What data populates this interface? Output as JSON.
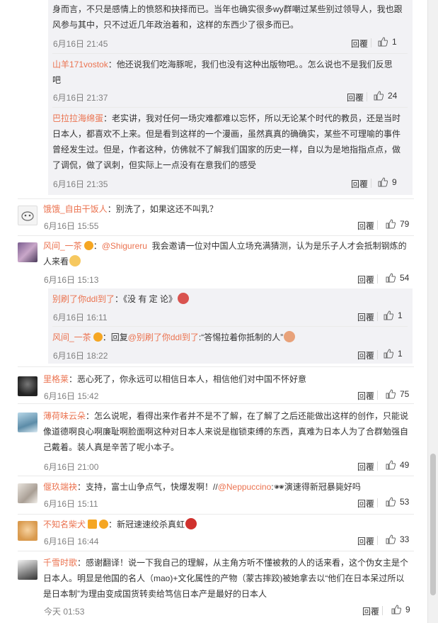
{
  "actions": {
    "reply": "回覆"
  },
  "thread_replies": [
    {
      "text_lines": [
        "身而言，不只是感情上的愤怒和抉择而已。当年也确实很多wy群嘲过某些别过领导人，我也跟",
        "风参与其中，只不过近几年政治着和，这样的东西少了很多而已。"
      ],
      "time": "6月16日 21:45",
      "likes": "1"
    },
    {
      "user": "山羊171vostok",
      "text_lines": [
        "：他还说我们吃海豚呢，我们也没有这种出版物吧。。怎么说也不是我们反思",
        "吧"
      ],
      "time": "6月16日 21:37",
      "likes": "24"
    },
    {
      "user": "巴拉拉海绵蛋",
      "text_lines": [
        "：老实讲，我对任何一场灾难都难以忘怀，所以无论某个时代的教员，还是当时",
        "日本人，都喜欢不上来。但是看到这样的一个漫画，虽然真真的确确实，某些不可理喻的事件",
        "曾经发生过。但是，作者这种，仿佛就不了解我们国家的历史一样，自以为是地指指点点，做",
        "了调侃，做了讽刺，但实际上一点没有在意我们的感受"
      ],
      "time": "6月16日 21:35",
      "likes": "9"
    }
  ],
  "comments": [
    {
      "user": "饿饿_自由干饭人",
      "text": "：别洗了，如果这还不叫乳？",
      "time": "6月16日 15:55",
      "likes": "79"
    },
    {
      "user": "风间_一茶",
      "mention": "@Shigureru",
      "text_lines": [
        "我会邀请一位对中国人立场充满猜测，认为是乐子人才会抵制钢炼的",
        "人来看"
      ],
      "time": "6月16日 15:13",
      "likes": "54",
      "replies": [
        {
          "user": "别刷了你ddl到了",
          "text": "：《没 有 定 论》",
          "time": "6月16日 16:11",
          "likes": "1"
        },
        {
          "user": "风间_一茶",
          "prefix": "：回复",
          "mention": "@别刷了你ddl到了",
          "text": ":“答惕拉着你抵制的人”",
          "time": "6月16日 18:22",
          "likes": "1"
        }
      ]
    },
    {
      "user": "里格莱",
      "text": "：恶心死了，你永远可以相信日本人，相信他们对中国不怀好意",
      "time": "6月16日 15:42",
      "likes": "75"
    },
    {
      "user": "薄荷味云朵",
      "text_lines": [
        "：怎么说呢，看得出来作者并不是不了解，在了解了之后还能做出这样的创作，只能说",
        "像道德啊良心啊廉耻啊脸面啊这种对日本人来说是枷锁束缚的东西，真难为日本人为了合群勉强自",
        "己戴着。装人真是辛苦了呢小本子。"
      ],
      "time": "6月16日 21:00",
      "likes": "49"
    },
    {
      "user": "偃玖端袂",
      "text": "：支持，富士山争点气，快爆发啊！//",
      "mention": "@Neppuccino",
      "text2": ":🕶演速得新冠暴毙好吗",
      "time": "6月16日 15:11",
      "likes": "53"
    },
    {
      "user": "不知名柴犬",
      "text": "：新冠速速绞杀真虹",
      "time": "6月16日 16:44",
      "likes": "33"
    },
    {
      "user": "千雪时歌",
      "text_lines": [
        "：感谢翻译！说一下我自己的理解，从主角方听不懂被救的人的话来看，这个伪女主是个",
        "日本人。明显是他国的名人（mao)+文化属性的产物（蒙古摔跤)被她拿去以“他们在日本呆过所以",
        "是日本制”为理由变成国货转卖给笃信日本产是最好的日本人"
      ],
      "time": "今天 01:53",
      "likes": "9"
    }
  ]
}
